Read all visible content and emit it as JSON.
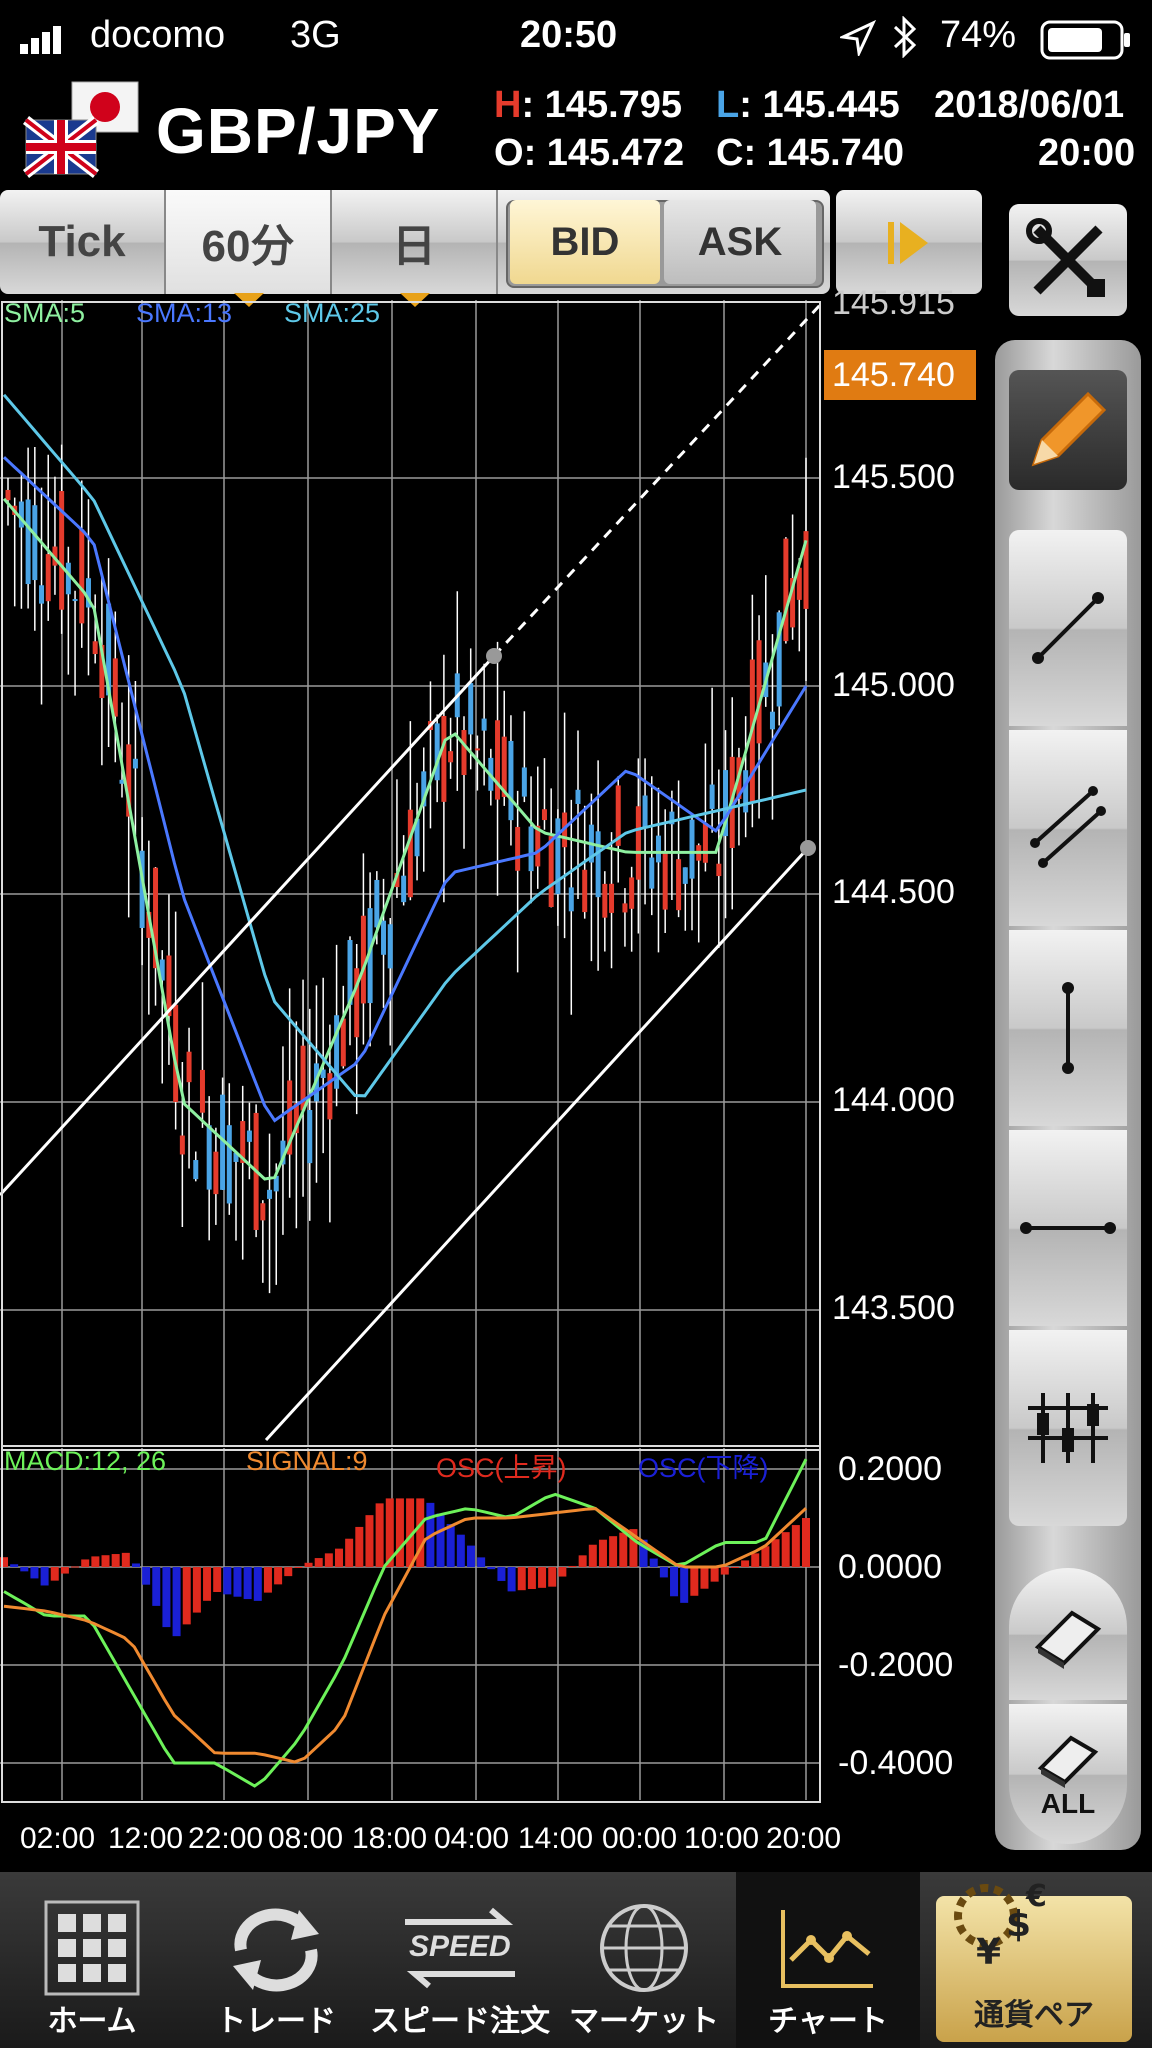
{
  "status_bar": {
    "carrier": "docomo",
    "network": "3G",
    "time": "20:50",
    "battery": "74%"
  },
  "header": {
    "pair": "GBP/JPY",
    "high_label": "H",
    "high": "145.795",
    "low_label": "L",
    "low": "145.445",
    "open_label": "O",
    "open": "145.472",
    "close_label": "C",
    "close": "145.740",
    "date": "2018/06/01",
    "time": "20:00"
  },
  "tabs": {
    "tick": "Tick",
    "min60": "60分",
    "day": "日",
    "bid": "BID",
    "ask": "ASK"
  },
  "chart": {
    "legend": [
      {
        "name": "SMA:5",
        "color": "#8ef0a0"
      },
      {
        "name": "SMA:13",
        "color": "#4a78ff"
      },
      {
        "name": "SMA:25",
        "color": "#5ec8e8"
      }
    ],
    "top_label": "145.915",
    "current_price": "145.740",
    "y_labels": [
      "145.500",
      "145.000",
      "144.500",
      "144.000",
      "143.500"
    ],
    "x_labels": [
      "02:00",
      "12:00",
      "22:00",
      "08:00",
      "18:00",
      "04:00",
      "14:00",
      "00:00",
      "10:00",
      "20:00"
    ],
    "colors": {
      "up": "#e53b2c",
      "down": "#4aa4e6",
      "grid": "#9a9a9a",
      "current": "#e07b12"
    }
  },
  "chart_data": [
    {
      "type": "line",
      "title": "",
      "x": [
        "02:00",
        "12:00",
        "22:00",
        "08:00",
        "18:00",
        "04:00",
        "14:00",
        "00:00",
        "10:00",
        "20:00"
      ],
      "ylim": [
        143.2,
        145.915
      ],
      "series": [
        {
          "name": "SMA:5",
          "values": [
            145.45,
            145.2,
            144.0,
            143.8,
            144.3,
            144.9,
            144.65,
            144.6,
            144.6,
            145.35
          ]
        },
        {
          "name": "SMA:13",
          "values": [
            145.55,
            145.35,
            144.5,
            143.95,
            144.1,
            144.55,
            144.6,
            144.8,
            144.65,
            145.0
          ]
        },
        {
          "name": "SMA:25",
          "values": [
            145.7,
            145.45,
            145.0,
            144.25,
            144.0,
            144.3,
            144.5,
            144.65,
            144.7,
            144.75
          ]
        }
      ]
    },
    {
      "type": "bar",
      "title": "",
      "legend": [
        {
          "name": "MACD:12, 26",
          "color": "#6df25a"
        },
        {
          "name": "SIGNAL:9",
          "color": "#f08a30"
        },
        {
          "name": "OSC(上昇)",
          "color": "#e02a1e"
        },
        {
          "name": "OSC(下降)",
          "color": "#1a20d6"
        }
      ],
      "y_labels": [
        "0.2000",
        "0.0000",
        "-0.2000",
        "-0.4000"
      ],
      "ylim": [
        -0.47,
        0.25
      ],
      "series": [
        {
          "name": "MACD:12, 26",
          "values": [
            -0.05,
            -0.1,
            -0.1,
            -0.25,
            -0.4,
            -0.4,
            -0.45,
            -0.35,
            -0.2,
            0.0,
            0.1,
            0.12,
            0.1,
            0.15,
            0.12,
            0.05,
            0.0,
            0.05,
            0.05,
            0.22
          ]
        },
        {
          "name": "SIGNAL:9",
          "values": [
            -0.08,
            -0.09,
            -0.11,
            -0.15,
            -0.3,
            -0.38,
            -0.38,
            -0.4,
            -0.32,
            -0.1,
            0.06,
            0.1,
            0.1,
            0.11,
            0.12,
            0.06,
            0.0,
            0.0,
            0.04,
            0.12
          ]
        },
        {
          "name": "OSC",
          "values": [
            0.02,
            -0.04,
            0.02,
            0.03,
            -0.15,
            -0.05,
            -0.07,
            0.0,
            0.04,
            0.14,
            0.14,
            0.05,
            -0.05,
            -0.04,
            0.05,
            0.08,
            -0.08,
            -0.02,
            0.04,
            0.1
          ]
        }
      ]
    }
  ],
  "macd": {
    "legend": [
      {
        "name": "MACD:12, 26",
        "color": "#6df25a"
      },
      {
        "name": "SIGNAL:9",
        "color": "#f08a30"
      },
      {
        "name": "OSC(上昇)",
        "color": "#e02a1e"
      },
      {
        "name": "OSC(下降)",
        "color": "#1a20d6"
      }
    ],
    "y_labels": [
      "0.2000",
      "0.0000",
      "-0.2000",
      "-0.4000"
    ]
  },
  "toolbar": {
    "eraser_all": "ALL"
  },
  "nav": {
    "home": "ホーム",
    "trade": "トレード",
    "speed": "スピード注文",
    "speed_badge": "SPEED",
    "market": "マーケット",
    "chart": "チャート",
    "currency": "通貨ペア"
  }
}
